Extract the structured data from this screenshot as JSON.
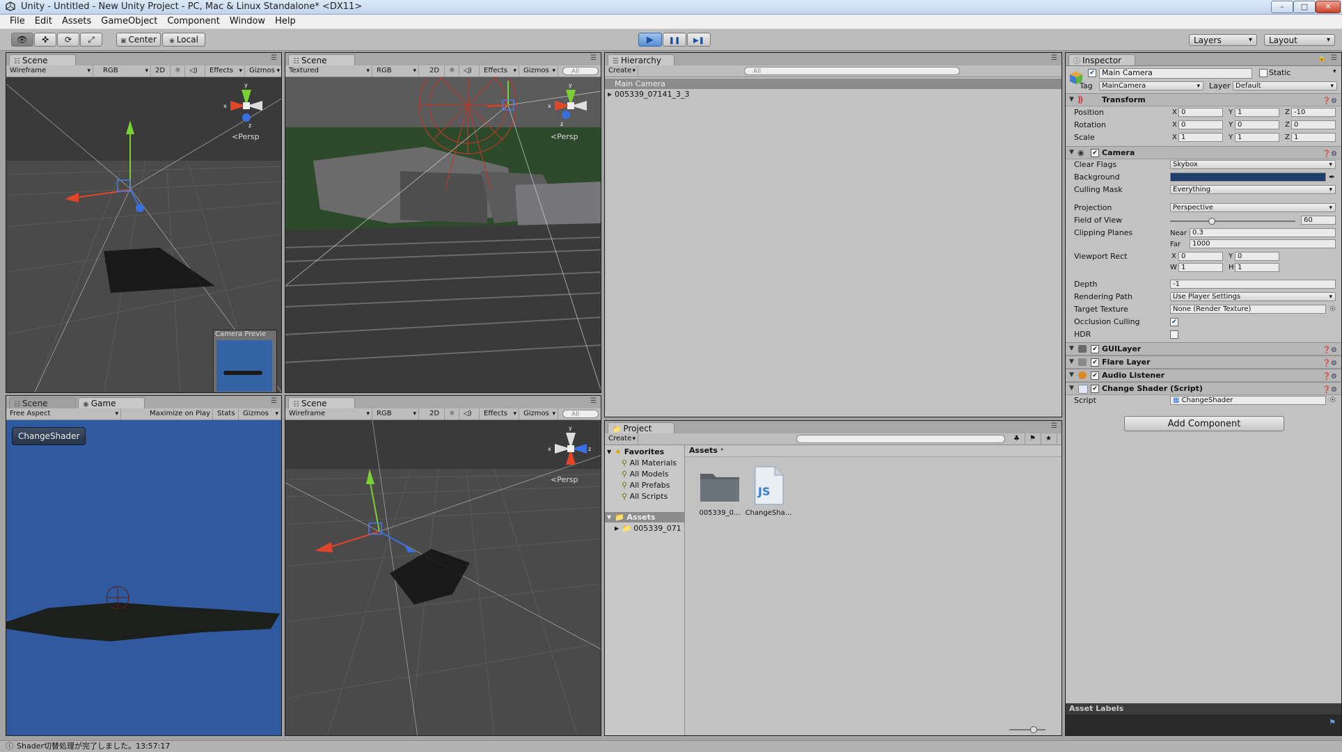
{
  "window": {
    "title": "Unity - Untitled - New Unity Project - PC, Mac & Linux Standalone* <DX11>",
    "controls": [
      "–",
      "□",
      "✕"
    ]
  },
  "menu": [
    "File",
    "Edit",
    "Assets",
    "GameObject",
    "Component",
    "Window",
    "Help"
  ],
  "toolbar": {
    "tools": [
      "👁",
      "✜",
      "⟳",
      "⤢"
    ],
    "pivot": "Center",
    "space": "Local",
    "play": "▶",
    "pause": "❚❚",
    "step": "▶❚",
    "layers": "Layers",
    "layout": "Layout"
  },
  "scene_tl": {
    "tab": "Scene",
    "bar": [
      "Wireframe",
      "RGB",
      "2D",
      "☼",
      "◁)",
      "Effects",
      "Gizmos"
    ],
    "persp": "<Persp",
    "preview_label": "Camera Previe"
  },
  "scene_tr": {
    "tab": "Scene",
    "bar": [
      "Textured",
      "RGB",
      "2D",
      "☼",
      "◁)",
      "Effects",
      "Gizmos"
    ],
    "search": "All",
    "persp": "<Persp"
  },
  "scene_br": {
    "tab": "Scene",
    "bar": [
      "Wireframe",
      "RGB",
      "2D",
      "☼",
      "◁)",
      "Effects",
      "Gizmos"
    ],
    "search": "All",
    "persp": "<Persp"
  },
  "game": {
    "tabs": [
      "Scene",
      "Game"
    ],
    "bar": [
      "Free Aspect",
      "Maximize on Play",
      "Stats",
      "Gizmos"
    ],
    "button": "ChangeShader"
  },
  "hierarchy": {
    "tab": "Hierarchy",
    "create": "Create",
    "search": "All",
    "items": [
      "Main Camera",
      "005339_07141_3_3"
    ]
  },
  "project": {
    "tab": "Project",
    "create": "Create",
    "favorites_label": "Favorites",
    "favorites": [
      "All Materials",
      "All Models",
      "All Prefabs",
      "All Scripts"
    ],
    "assets_label": "Assets",
    "asset_tree": [
      "005339_071"
    ],
    "breadcrumb": "Assets",
    "assets": [
      {
        "name": "005339_0...",
        "icon": "folder-icon"
      },
      {
        "name": "ChangeSha...",
        "icon": "js-script-icon",
        "glyph": "JS"
      }
    ]
  },
  "inspector": {
    "tab": "Inspector",
    "object_name": "Main Camera",
    "static_label": "Static",
    "tag_label": "Tag",
    "tag": "MainCamera",
    "layer_label": "Layer",
    "layer": "Default",
    "transform": {
      "title": "Transform",
      "rows": [
        {
          "label": "Position",
          "x": "0",
          "y": "1",
          "z": "-10"
        },
        {
          "label": "Rotation",
          "x": "0",
          "y": "0",
          "z": "0"
        },
        {
          "label": "Scale",
          "x": "1",
          "y": "1",
          "z": "1"
        }
      ]
    },
    "camera": {
      "title": "Camera",
      "clear_flags_label": "Clear Flags",
      "clear_flags": "Skybox",
      "background_label": "Background",
      "background_color": "#1f3d6b",
      "culling_mask_label": "Culling Mask",
      "culling_mask": "Everything",
      "projection_label": "Projection",
      "projection": "Perspective",
      "fov_label": "Field of View",
      "fov": "60",
      "fov_fraction": 0.32,
      "clipping_label": "Clipping Planes",
      "near_label": "Near",
      "near": "0.3",
      "far_label": "Far",
      "far": "1000",
      "viewport_label": "Viewport Rect",
      "vx": "0",
      "vy": "0",
      "vw": "1",
      "vh": "1",
      "depth_label": "Depth",
      "depth": "-1",
      "rendering_path_label": "Rendering Path",
      "rendering_path": "Use Player Settings",
      "target_texture_label": "Target Texture",
      "target_texture": "None (Render Texture)",
      "occlusion_label": "Occlusion Culling",
      "occlusion": true,
      "hdr_label": "HDR",
      "hdr": false
    },
    "components": [
      "GUILayer",
      "Flare Layer",
      "Audio Listener",
      "Change Shader (Script)"
    ],
    "script_label": "Script",
    "script": "ChangeShader",
    "add_component": "Add Component",
    "asset_labels": "Asset Labels"
  },
  "status": "Shader切替処理が完了しました。13:57:17",
  "colors": {
    "scene_bg": "#3e3e3e",
    "game_bg": "#2f5aa0",
    "accent_play": "#4a8ee0"
  }
}
